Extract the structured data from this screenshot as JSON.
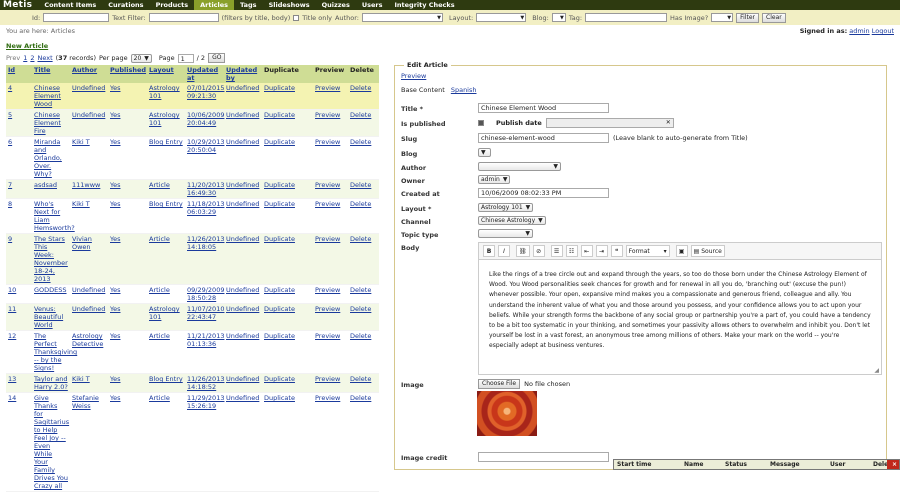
{
  "nav": {
    "logo": "Metis",
    "items": [
      "Content Items",
      "Curations",
      "Products",
      "Articles",
      "Tags",
      "Slideshows",
      "Quizzes",
      "Users",
      "Integrity Checks"
    ]
  },
  "filters": {
    "id_label": "Id:",
    "text_filter_label": "Text Filter:",
    "text_filter_hint": "(filters by title, body)",
    "title_only_label": "Title only",
    "author_label": "Author:",
    "layout_label": "Layout:",
    "blog_label": "Blog:",
    "tag_label": "Tag:",
    "has_image_label": "Has Image?",
    "filter_button": "Filter",
    "clear_button": "Clear"
  },
  "breadcrumb": "You are here: Articles",
  "auth": {
    "signed_in_as": "Signed in as:",
    "user": "admin",
    "logout": "Logout"
  },
  "new_article": "New Article",
  "pager": {
    "prev": "Prev",
    "page1": "1",
    "page2": "2",
    "next": "Next",
    "records_open": "(",
    "records": "37",
    "records_close": "records)",
    "per_page_label": "Per page",
    "per_page_value": "20",
    "page_label": "Page",
    "page_value": "1",
    "page_of": "/ 2",
    "go": "GO"
  },
  "table": {
    "headers": [
      "Id",
      "Title",
      "Author",
      "Published",
      "Layout",
      "Updated at",
      "Updated by",
      "Duplicate",
      "Preview",
      "Delete"
    ],
    "rows": [
      {
        "id": "4",
        "title": "Chinese Element Wood",
        "author": "Undefined",
        "published": "Yes",
        "layout": "Astrology 101",
        "updated_at": "07/01/2015 09:21:30",
        "updated_by": "Undefined",
        "duplicate": "Duplicate",
        "preview": "Preview",
        "delete": "Delete"
      },
      {
        "id": "5",
        "title": "Chinese Element Fire",
        "author": "Undefined",
        "published": "Yes",
        "layout": "Astrology 101",
        "updated_at": "10/06/2009 20:04:49",
        "updated_by": "Undefined",
        "duplicate": "Duplicate",
        "preview": "Preview",
        "delete": "Delete"
      },
      {
        "id": "6",
        "title": "Miranda and Orlando, Over. Why?",
        "author": "Kiki T",
        "published": "Yes",
        "layout": "Blog Entry",
        "updated_at": "10/29/2013 20:50:04",
        "updated_by": "Undefined",
        "duplicate": "Duplicate",
        "preview": "Preview",
        "delete": "Delete"
      },
      {
        "id": "7",
        "title": "asdsad",
        "author": "111www",
        "published": "Yes",
        "layout": "Article",
        "updated_at": "11/20/2013 16:49:30",
        "updated_by": "Undefined",
        "duplicate": "Duplicate",
        "preview": "Preview",
        "delete": "Delete"
      },
      {
        "id": "8",
        "title": "Who's Next for Liam Hemsworth?",
        "author": "Kiki T",
        "published": "Yes",
        "layout": "Blog Entry",
        "updated_at": "11/18/2013 06:03:29",
        "updated_by": "Undefined",
        "duplicate": "Duplicate",
        "preview": "Preview",
        "delete": "Delete"
      },
      {
        "id": "9",
        "title": "The Stars This Week: November 18-24, 2013",
        "author": "Vivian Owen",
        "published": "Yes",
        "layout": "Article",
        "updated_at": "11/26/2013 14:18:05",
        "updated_by": "Undefined",
        "duplicate": "Duplicate",
        "preview": "Preview",
        "delete": "Delete"
      },
      {
        "id": "10",
        "title": "GODDESS",
        "author": "Undefined",
        "published": "Yes",
        "layout": "Article",
        "updated_at": "09/29/2009 18:50:28",
        "updated_by": "Undefined",
        "duplicate": "Duplicate",
        "preview": "Preview",
        "delete": "Delete"
      },
      {
        "id": "11",
        "title": "Venus: Beautiful World",
        "author": "Undefined",
        "published": "Yes",
        "layout": "Astrology 101",
        "updated_at": "11/07/2010 22:43:47",
        "updated_by": "Undefined",
        "duplicate": "Duplicate",
        "preview": "Preview",
        "delete": "Delete"
      },
      {
        "id": "12",
        "title": "The Perfect Thanksgiving -- by the Signs!",
        "author": "Astrology Detective",
        "published": "Yes",
        "layout": "Article",
        "updated_at": "11/21/2013 01:13:36",
        "updated_by": "Undefined",
        "duplicate": "Duplicate",
        "preview": "Preview",
        "delete": "Delete"
      },
      {
        "id": "13",
        "title": "Taylor and Harry 2.0?",
        "author": "Kiki T",
        "published": "Yes",
        "layout": "Blog Entry",
        "updated_at": "11/26/2013 14:18:52",
        "updated_by": "Undefined",
        "duplicate": "Duplicate",
        "preview": "Preview",
        "delete": "Delete"
      },
      {
        "id": "14",
        "title": "Give Thanks for Sagittarius to Help Feel Joy -- Even While Your Family Drives You Crazy all",
        "author": "Stefanie Weiss",
        "published": "Yes",
        "layout": "Article",
        "updated_at": "11/29/2013 15:26:19",
        "updated_by": "Undefined",
        "duplicate": "Duplicate",
        "preview": "Preview",
        "delete": "Delete"
      }
    ]
  },
  "edit": {
    "legend": "Edit Article",
    "preview": "Preview",
    "tab_base": "Base Content",
    "tab_spanish": "Spanish",
    "title_label": "Title *",
    "title_value": "Chinese Element Wood",
    "is_published_label": "Is published",
    "publish_date_label": "Publish date",
    "slug_label": "Slug",
    "slug_value": "chinese-element-wood",
    "slug_hint": "(Leave blank to auto-generate from Title)",
    "blog_label": "Blog",
    "author_label": "Author",
    "owner_label": "Owner",
    "owner_value": "admin",
    "created_at_label": "Created at",
    "created_at_value": "10/06/2009 08:02:33 PM",
    "layout_label": "Layout *",
    "layout_value": "Astrology 101",
    "channel_label": "Channel",
    "channel_value": "Chinese Astrology",
    "topic_type_label": "Topic type",
    "body_label": "Body",
    "toolbar": {
      "bold": "B",
      "italic": "I",
      "format": "Format",
      "source": "Source"
    },
    "body_text": "Like the rings of a tree circle out and expand through the years, so too do those born under the Chinese Astrology Element of Wood. You Wood personalities seek chances for growth and for renewal in all you do, 'branching out' (excuse the pun!) whenever possible. Your open, expansive mind makes you a compassionate and generous friend, colleague and ally. You understand the inherent value of what you and those around you possess, and your confidence allows you to act upon your beliefs. While your strength forms the backbone of any social group or partnership you're a part of, you could have a tendency to be a bit too systematic in your thinking, and sometimes your passivity allows others to overwhelm and inhibit you. Don't let yourself be lost in a vast forest, an anonymous tree among millions of others. Make your mark on the world -- you're especially adept at business ventures.",
    "image_label": "Image",
    "choose_file": "Choose File",
    "no_file": "No file chosen",
    "image_credit_label": "Image credit"
  },
  "jobs": {
    "columns": [
      "Start time",
      "Name",
      "Status",
      "Message",
      "User",
      "Delete"
    ],
    "close": "×"
  }
}
